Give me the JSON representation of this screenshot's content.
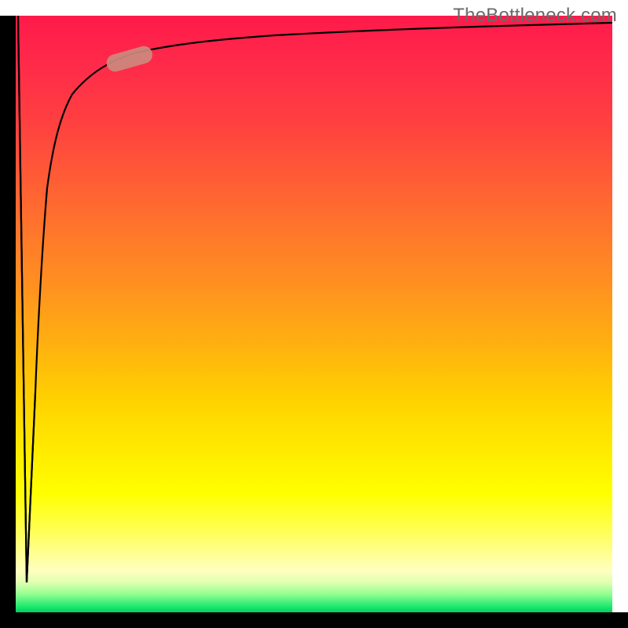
{
  "watermark": "TheBottleneck.com",
  "colors": {
    "gradient_top": "#ff1a4a",
    "gradient_mid": "#ffe000",
    "gradient_bottom": "#00d060",
    "axis": "#000000",
    "curve": "#000000",
    "marker": "#cc8a7e"
  },
  "chart_data": {
    "type": "line",
    "title": "",
    "xlabel": "",
    "ylabel": "",
    "xlim": [
      0,
      100
    ],
    "ylim": [
      0,
      100
    ],
    "series": [
      {
        "name": "bottleneck-curve",
        "x": [
          0,
          1,
          2,
          3,
          4,
          5,
          7,
          10,
          14,
          18,
          25,
          35,
          50,
          70,
          85,
          100
        ],
        "y": [
          100,
          5,
          45,
          68,
          78,
          83,
          87.5,
          90,
          92,
          93,
          94,
          95,
          96,
          97,
          97.5,
          98
        ]
      }
    ],
    "marker": {
      "on_series": "bottleneck-curve",
      "x_range": [
        14,
        22
      ],
      "center_x": 18,
      "center_y": 92.8
    },
    "background_gradient": {
      "direction": "vertical",
      "stops": [
        {
          "pos": 0.0,
          "color": "#ff1a4a"
        },
        {
          "pos": 0.4,
          "color": "#ff8a20"
        },
        {
          "pos": 0.75,
          "color": "#ffff00"
        },
        {
          "pos": 0.97,
          "color": "#80ff80"
        },
        {
          "pos": 1.0,
          "color": "#00d060"
        }
      ]
    }
  }
}
